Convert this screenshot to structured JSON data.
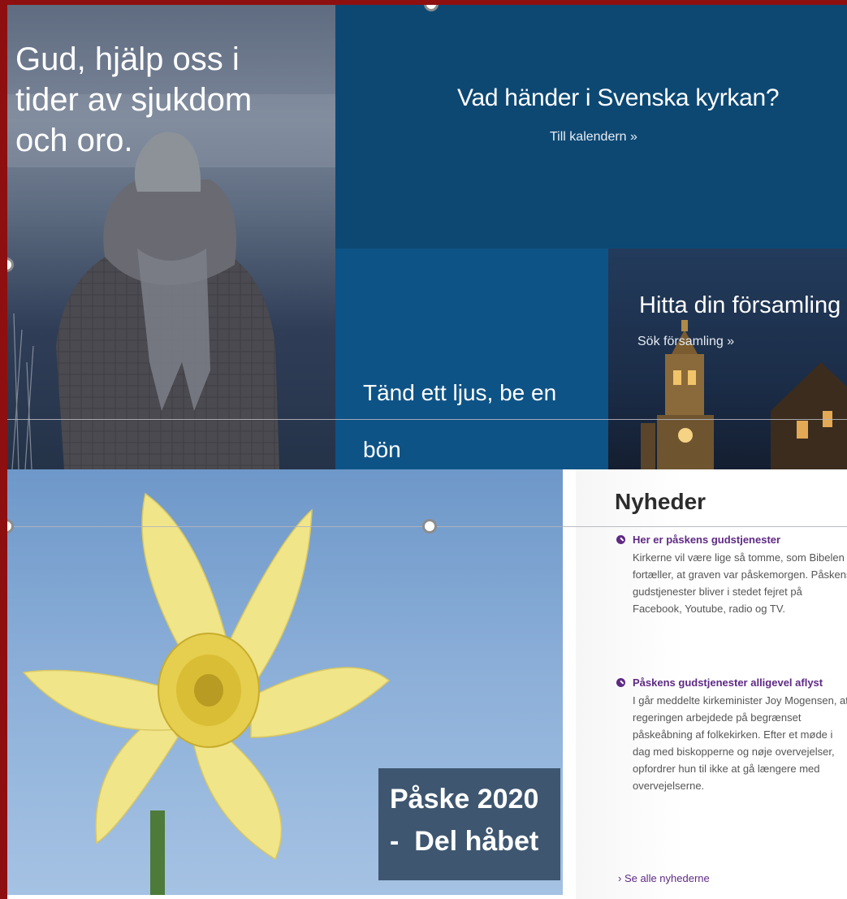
{
  "hero": {
    "title": "Gud, hjälp oss i\ntider av sjukdom\noch oro."
  },
  "events_tile": {
    "title": "Vad händer i Svenska kyrkan?",
    "link": "Till kalendern »"
  },
  "candle_tile": {
    "title_line1": "Tänd ett ljus, be en",
    "title_line2": "bön"
  },
  "parish_tile": {
    "title": "Hitta din församling",
    "link": "Sök församling »"
  },
  "easter_banner": {
    "line1": "Påske 2020",
    "line2": "-  Del håbet"
  },
  "news": {
    "heading": "Nyheder",
    "items": [
      {
        "headline": "Her er påskens gudstjenester",
        "body": "Kirkerne vil være lige så tomme, som Bibelen fortæller, at graven var påskemorgen. Påskens gudstjenester bliver i stedet fejret på Facebook, Youtube, radio og TV."
      },
      {
        "headline": "Påskens gudstjenester alligevel aflyst",
        "body": "I går meddelte kirkeminister Joy Mogensen, at regeringen arbejdede på begrænset påskeåbning af folkekirken. Efter et møde i dag med biskopperne og nøje overvejelser, opfordrer hun til ikke at gå længere med overvejelserne."
      }
    ],
    "see_all": "› Se alle nyhederne"
  },
  "colors": {
    "frame_border": "#8e0f0f",
    "dark_blue": "#0d4873",
    "mid_blue": "#0e5386",
    "accent_purple": "#5e2a84",
    "banner_bg": "#3e5670"
  }
}
